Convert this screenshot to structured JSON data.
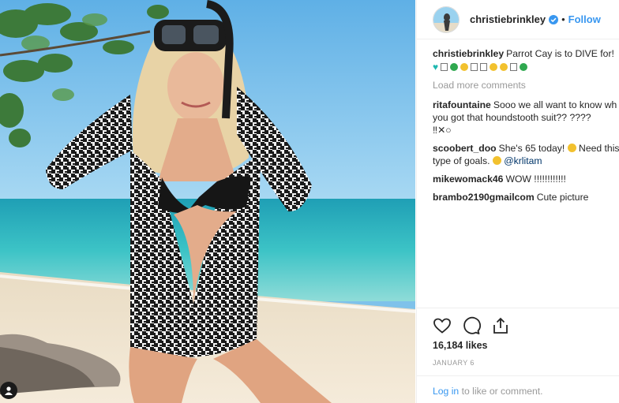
{
  "header": {
    "username": "christiebrinkley",
    "separator": "•",
    "follow_label": "Follow"
  },
  "caption": {
    "username": "christiebrinkley",
    "text": "Parrot Cay is to DIVE for!"
  },
  "load_more_label": "Load more comments",
  "comments": [
    {
      "username": "ritafountaine",
      "line1": "Sooo we all want to know wh",
      "line2": "you got that houndstooth suit?? ????",
      "line3": "‼✕○"
    },
    {
      "username": "scoobert_doo",
      "line1": "She's 65 today!",
      "line2_prefix": "type of goals.",
      "line1_suffix": "Need this",
      "mention": "@krlitam"
    },
    {
      "username": "mikewomack46",
      "text": "WOW !!!!!!!!!!!!"
    },
    {
      "username": "brambo2190gmailcom",
      "text": "Cute picture"
    }
  ],
  "likes_text": "16,184 likes",
  "date_text": "JANUARY 6",
  "login": {
    "link_label": "Log in",
    "rest": "to like or comment."
  },
  "colors": {
    "accent": "#3897f0",
    "verified": "#3897f0",
    "muted": "#999999"
  }
}
